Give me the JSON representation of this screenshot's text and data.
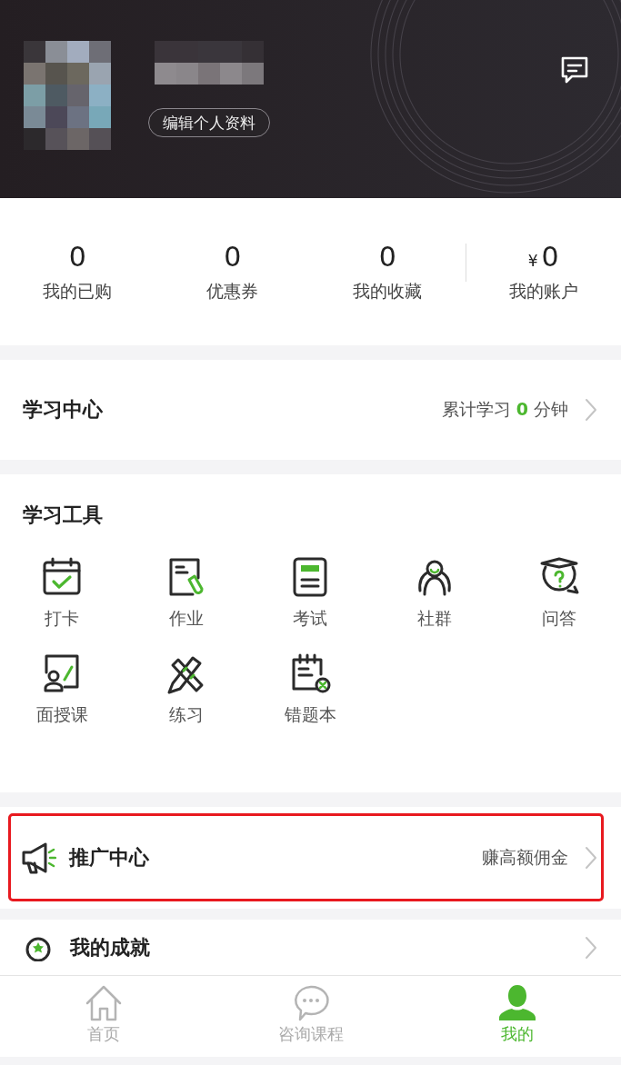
{
  "header": {
    "edit_profile": "编辑个人资料"
  },
  "stats": [
    {
      "value": "0",
      "label": "我的已购"
    },
    {
      "value": "0",
      "label": "优惠券"
    },
    {
      "value": "0",
      "label": "我的收藏"
    },
    {
      "currency": "¥",
      "value": "0",
      "label": "我的账户"
    }
  ],
  "learning_center": {
    "title": "学习中心",
    "summary": "累计学习 **0** 分钟"
  },
  "tools": {
    "title": "学习工具",
    "items": [
      {
        "label": "打卡"
      },
      {
        "label": "作业"
      },
      {
        "label": "考试"
      },
      {
        "label": "社群"
      },
      {
        "label": "问答"
      },
      {
        "label": "面授课"
      },
      {
        "label": "练习"
      },
      {
        "label": "错题本"
      }
    ]
  },
  "promotion": {
    "title": "推广中心",
    "hint": "赚高额佣金",
    "highlighted": true
  },
  "achievement": {
    "title": "我的成就"
  },
  "tab_bar": [
    {
      "label": "首页",
      "selected": false
    },
    {
      "label": "咨询课程",
      "selected": false
    },
    {
      "label": "我的",
      "selected": true
    }
  ]
}
